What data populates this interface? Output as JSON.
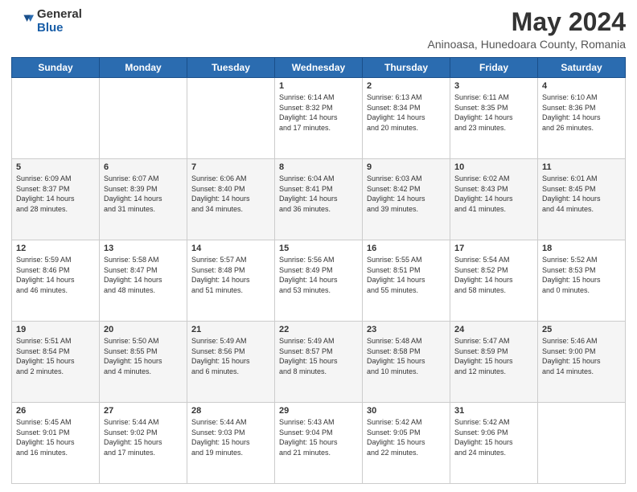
{
  "header": {
    "logo_general": "General",
    "logo_blue": "Blue",
    "title": "May 2024",
    "subtitle": "Aninoasa, Hunedoara County, Romania"
  },
  "days_of_week": [
    "Sunday",
    "Monday",
    "Tuesday",
    "Wednesday",
    "Thursday",
    "Friday",
    "Saturday"
  ],
  "weeks": [
    [
      {
        "day": "",
        "info": ""
      },
      {
        "day": "",
        "info": ""
      },
      {
        "day": "",
        "info": ""
      },
      {
        "day": "1",
        "info": "Sunrise: 6:14 AM\nSunset: 8:32 PM\nDaylight: 14 hours\nand 17 minutes."
      },
      {
        "day": "2",
        "info": "Sunrise: 6:13 AM\nSunset: 8:34 PM\nDaylight: 14 hours\nand 20 minutes."
      },
      {
        "day": "3",
        "info": "Sunrise: 6:11 AM\nSunset: 8:35 PM\nDaylight: 14 hours\nand 23 minutes."
      },
      {
        "day": "4",
        "info": "Sunrise: 6:10 AM\nSunset: 8:36 PM\nDaylight: 14 hours\nand 26 minutes."
      }
    ],
    [
      {
        "day": "5",
        "info": "Sunrise: 6:09 AM\nSunset: 8:37 PM\nDaylight: 14 hours\nand 28 minutes."
      },
      {
        "day": "6",
        "info": "Sunrise: 6:07 AM\nSunset: 8:39 PM\nDaylight: 14 hours\nand 31 minutes."
      },
      {
        "day": "7",
        "info": "Sunrise: 6:06 AM\nSunset: 8:40 PM\nDaylight: 14 hours\nand 34 minutes."
      },
      {
        "day": "8",
        "info": "Sunrise: 6:04 AM\nSunset: 8:41 PM\nDaylight: 14 hours\nand 36 minutes."
      },
      {
        "day": "9",
        "info": "Sunrise: 6:03 AM\nSunset: 8:42 PM\nDaylight: 14 hours\nand 39 minutes."
      },
      {
        "day": "10",
        "info": "Sunrise: 6:02 AM\nSunset: 8:43 PM\nDaylight: 14 hours\nand 41 minutes."
      },
      {
        "day": "11",
        "info": "Sunrise: 6:01 AM\nSunset: 8:45 PM\nDaylight: 14 hours\nand 44 minutes."
      }
    ],
    [
      {
        "day": "12",
        "info": "Sunrise: 5:59 AM\nSunset: 8:46 PM\nDaylight: 14 hours\nand 46 minutes."
      },
      {
        "day": "13",
        "info": "Sunrise: 5:58 AM\nSunset: 8:47 PM\nDaylight: 14 hours\nand 48 minutes."
      },
      {
        "day": "14",
        "info": "Sunrise: 5:57 AM\nSunset: 8:48 PM\nDaylight: 14 hours\nand 51 minutes."
      },
      {
        "day": "15",
        "info": "Sunrise: 5:56 AM\nSunset: 8:49 PM\nDaylight: 14 hours\nand 53 minutes."
      },
      {
        "day": "16",
        "info": "Sunrise: 5:55 AM\nSunset: 8:51 PM\nDaylight: 14 hours\nand 55 minutes."
      },
      {
        "day": "17",
        "info": "Sunrise: 5:54 AM\nSunset: 8:52 PM\nDaylight: 14 hours\nand 58 minutes."
      },
      {
        "day": "18",
        "info": "Sunrise: 5:52 AM\nSunset: 8:53 PM\nDaylight: 15 hours\nand 0 minutes."
      }
    ],
    [
      {
        "day": "19",
        "info": "Sunrise: 5:51 AM\nSunset: 8:54 PM\nDaylight: 15 hours\nand 2 minutes."
      },
      {
        "day": "20",
        "info": "Sunrise: 5:50 AM\nSunset: 8:55 PM\nDaylight: 15 hours\nand 4 minutes."
      },
      {
        "day": "21",
        "info": "Sunrise: 5:49 AM\nSunset: 8:56 PM\nDaylight: 15 hours\nand 6 minutes."
      },
      {
        "day": "22",
        "info": "Sunrise: 5:49 AM\nSunset: 8:57 PM\nDaylight: 15 hours\nand 8 minutes."
      },
      {
        "day": "23",
        "info": "Sunrise: 5:48 AM\nSunset: 8:58 PM\nDaylight: 15 hours\nand 10 minutes."
      },
      {
        "day": "24",
        "info": "Sunrise: 5:47 AM\nSunset: 8:59 PM\nDaylight: 15 hours\nand 12 minutes."
      },
      {
        "day": "25",
        "info": "Sunrise: 5:46 AM\nSunset: 9:00 PM\nDaylight: 15 hours\nand 14 minutes."
      }
    ],
    [
      {
        "day": "26",
        "info": "Sunrise: 5:45 AM\nSunset: 9:01 PM\nDaylight: 15 hours\nand 16 minutes."
      },
      {
        "day": "27",
        "info": "Sunrise: 5:44 AM\nSunset: 9:02 PM\nDaylight: 15 hours\nand 17 minutes."
      },
      {
        "day": "28",
        "info": "Sunrise: 5:44 AM\nSunset: 9:03 PM\nDaylight: 15 hours\nand 19 minutes."
      },
      {
        "day": "29",
        "info": "Sunrise: 5:43 AM\nSunset: 9:04 PM\nDaylight: 15 hours\nand 21 minutes."
      },
      {
        "day": "30",
        "info": "Sunrise: 5:42 AM\nSunset: 9:05 PM\nDaylight: 15 hours\nand 22 minutes."
      },
      {
        "day": "31",
        "info": "Sunrise: 5:42 AM\nSunset: 9:06 PM\nDaylight: 15 hours\nand 24 minutes."
      },
      {
        "day": "",
        "info": ""
      }
    ]
  ]
}
